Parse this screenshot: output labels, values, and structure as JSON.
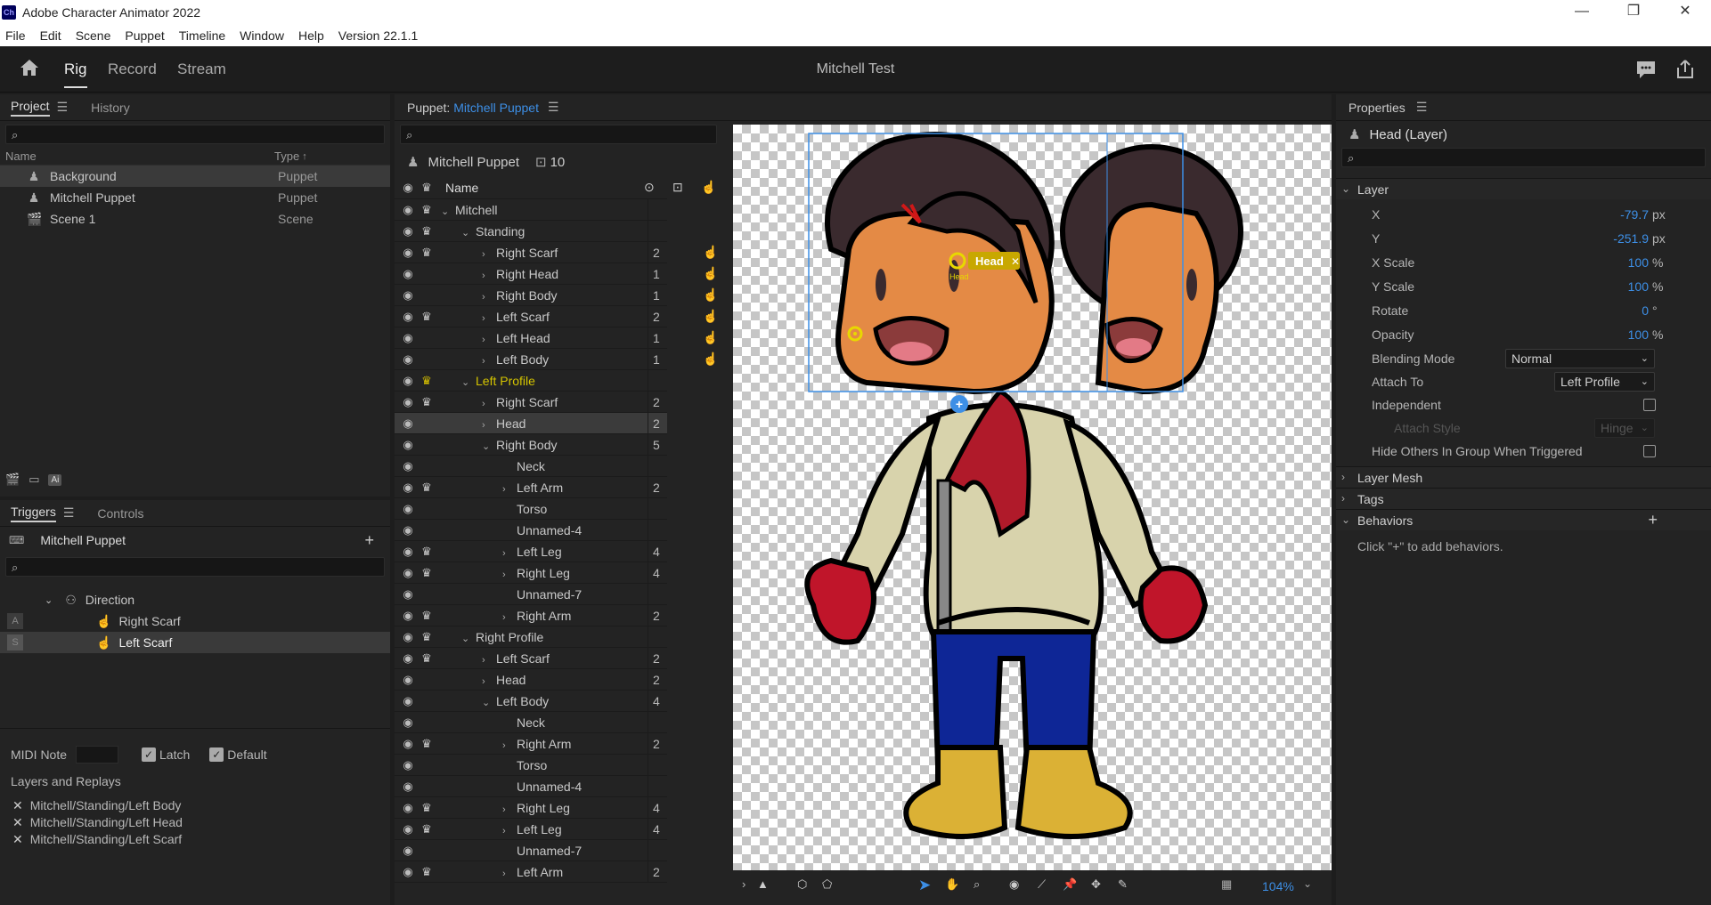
{
  "window": {
    "title": "Adobe Character Animator 2022",
    "icon_text": "Ch"
  },
  "menu": [
    "File",
    "Edit",
    "Scene",
    "Puppet",
    "Timeline",
    "Window",
    "Help",
    "Version 22.1.1"
  ],
  "workspace": {
    "tabs": [
      "Rig",
      "Record",
      "Stream"
    ],
    "active_tab": "Rig",
    "doc_title": "Mitchell Test"
  },
  "project_panel": {
    "tabs": [
      "Project",
      "History"
    ],
    "columns": {
      "name": "Name",
      "type": "Type"
    },
    "rows": [
      {
        "name": "Background",
        "type": "Puppet",
        "icon": "puppet-icon"
      },
      {
        "name": "Mitchell Puppet",
        "type": "Puppet",
        "icon": "puppet-icon"
      },
      {
        "name": "Scene 1",
        "type": "Scene",
        "icon": "scene-icon"
      }
    ],
    "ai_badge": "Ai"
  },
  "triggers_panel": {
    "tabs": [
      "Triggers",
      "Controls"
    ],
    "puppet_name": "Mitchell Puppet",
    "group": "Direction",
    "triggers": [
      {
        "key": "A",
        "name": "Right Scarf"
      },
      {
        "key": "S",
        "name": "Left Scarf"
      }
    ],
    "midi_label": "MIDI Note",
    "latch_label": "Latch",
    "default_label": "Default",
    "layers_title": "Layers and Replays",
    "layers": [
      "Mitchell/Standing/Left Body",
      "Mitchell/Standing/Left Head",
      "Mitchell/Standing/Left Scarf"
    ]
  },
  "puppet_panel": {
    "title_prefix": "Puppet:",
    "puppet_name": "Mitchell Puppet",
    "header_name": "Mitchell Puppet",
    "header_count": "10",
    "name_col": "Name",
    "rows": [
      {
        "name": "Mitchell",
        "depth": 0,
        "chev": "v",
        "crown": true,
        "count": "",
        "hand": false
      },
      {
        "name": "Standing",
        "depth": 1,
        "chev": "v",
        "crown": true,
        "count": "",
        "hand": false
      },
      {
        "name": "Right Scarf",
        "depth": 2,
        "chev": ">",
        "crown": true,
        "count": "2",
        "hand": true
      },
      {
        "name": "Right Head",
        "depth": 2,
        "chev": ">",
        "crown": false,
        "count": "1",
        "hand": true
      },
      {
        "name": "Right Body",
        "depth": 2,
        "chev": ">",
        "crown": false,
        "count": "1",
        "hand": true
      },
      {
        "name": "Left Scarf",
        "depth": 2,
        "chev": ">",
        "crown": true,
        "count": "2",
        "hand": true
      },
      {
        "name": "Left Head",
        "depth": 2,
        "chev": ">",
        "crown": false,
        "count": "1",
        "hand": true
      },
      {
        "name": "Left Body",
        "depth": 2,
        "chev": ">",
        "crown": false,
        "count": "1",
        "hand": true
      },
      {
        "name": "Left Profile",
        "depth": 1,
        "chev": "v",
        "crown": true,
        "gold": true,
        "count": "",
        "hand": false
      },
      {
        "name": "Right Scarf",
        "depth": 2,
        "chev": ">",
        "crown": true,
        "count": "2",
        "hand": false
      },
      {
        "name": "Head",
        "depth": 2,
        "chev": ">",
        "crown": false,
        "count": "2",
        "hand": false,
        "selected": true
      },
      {
        "name": "Right Body",
        "depth": 2,
        "chev": "v",
        "crown": false,
        "count": "5",
        "hand": false
      },
      {
        "name": "Neck",
        "depth": 3,
        "chev": "",
        "crown": false,
        "count": "",
        "hand": false
      },
      {
        "name": "Left Arm",
        "depth": 3,
        "chev": ">",
        "crown": true,
        "count": "2",
        "hand": false
      },
      {
        "name": "Torso",
        "depth": 3,
        "chev": "",
        "crown": false,
        "count": "",
        "hand": false
      },
      {
        "name": "Unnamed-4",
        "depth": 3,
        "chev": "",
        "crown": false,
        "count": "",
        "hand": false
      },
      {
        "name": "Left Leg",
        "depth": 3,
        "chev": ">",
        "crown": true,
        "count": "4",
        "hand": false
      },
      {
        "name": "Right Leg",
        "depth": 3,
        "chev": ">",
        "crown": true,
        "count": "4",
        "hand": false
      },
      {
        "name": "Unnamed-7",
        "depth": 3,
        "chev": "",
        "crown": false,
        "count": "",
        "hand": false
      },
      {
        "name": "Right Arm",
        "depth": 3,
        "chev": ">",
        "crown": true,
        "count": "2",
        "hand": false
      },
      {
        "name": "Right Profile",
        "depth": 1,
        "chev": "v",
        "crown": true,
        "count": "",
        "hand": false
      },
      {
        "name": "Left Scarf",
        "depth": 2,
        "chev": ">",
        "crown": true,
        "count": "2",
        "hand": false
      },
      {
        "name": "Head",
        "depth": 2,
        "chev": ">",
        "crown": false,
        "count": "2",
        "hand": false
      },
      {
        "name": "Left Body",
        "depth": 2,
        "chev": "v",
        "crown": false,
        "count": "4",
        "hand": false
      },
      {
        "name": "Neck",
        "depth": 3,
        "chev": "",
        "crown": false,
        "count": "",
        "hand": false
      },
      {
        "name": "Right Arm",
        "depth": 3,
        "chev": ">",
        "crown": true,
        "count": "2",
        "hand": false
      },
      {
        "name": "Torso",
        "depth": 3,
        "chev": "",
        "crown": false,
        "count": "",
        "hand": false
      },
      {
        "name": "Unnamed-4",
        "depth": 3,
        "chev": "",
        "crown": false,
        "count": "",
        "hand": false
      },
      {
        "name": "Right Leg",
        "depth": 3,
        "chev": ">",
        "crown": true,
        "count": "4",
        "hand": false
      },
      {
        "name": "Left Leg",
        "depth": 3,
        "chev": ">",
        "crown": true,
        "count": "4",
        "hand": false
      },
      {
        "name": "Unnamed-7",
        "depth": 3,
        "chev": "",
        "crown": false,
        "count": "",
        "hand": false
      },
      {
        "name": "Left Arm",
        "depth": 3,
        "chev": ">",
        "crown": true,
        "count": "2",
        "hand": false
      }
    ]
  },
  "canvas": {
    "handle_label": "Head",
    "handle_small_label": "Head",
    "zoom": "104%"
  },
  "properties": {
    "title": "Properties",
    "layer_title": "Head (Layer)",
    "section_layer": "Layer",
    "fields": [
      {
        "label": "X",
        "value": "-79.7",
        "unit": "px"
      },
      {
        "label": "Y",
        "value": "-251.9",
        "unit": "px"
      },
      {
        "label": "X Scale",
        "value": "100",
        "unit": "%"
      },
      {
        "label": "Y Scale",
        "value": "100",
        "unit": "%"
      },
      {
        "label": "Rotate",
        "value": "0",
        "unit": "°"
      },
      {
        "label": "Opacity",
        "value": "100",
        "unit": "%"
      }
    ],
    "blending_label": "Blending Mode",
    "blending_value": "Normal",
    "attach_label": "Attach To",
    "attach_value": "Left Profile",
    "independent_label": "Independent",
    "attach_style_label": "Attach Style",
    "attach_style_value": "Hinge",
    "hide_others_label": "Hide Others In Group When Triggered",
    "sections": [
      "Layer Mesh",
      "Tags",
      "Behaviors"
    ],
    "behaviors_hint": "Click \"+\" to add behaviors."
  },
  "colors": {
    "accent_blue": "#3d8fe6",
    "highlight_gold": "#d4c400"
  }
}
